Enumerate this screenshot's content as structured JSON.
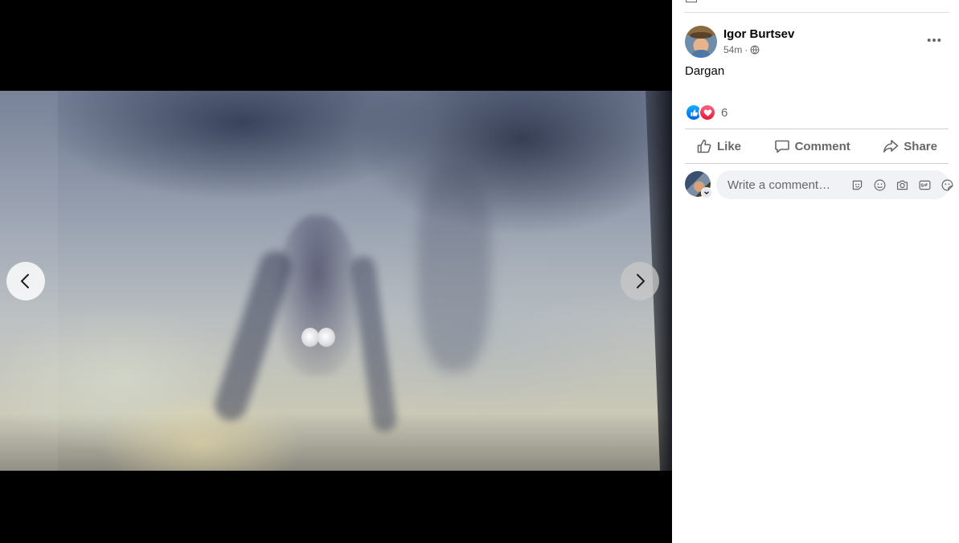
{
  "viewer": {
    "prev_icon": "chevron-left-icon",
    "next_icon": "chevron-right-icon"
  },
  "post": {
    "author": "Igor Burtsev",
    "time": "54m",
    "separator": "·",
    "privacy_icon": "globe-icon",
    "text": "Dargan",
    "reactions": {
      "types": [
        "like",
        "love"
      ],
      "count": "6"
    }
  },
  "actions": {
    "like_label": "Like",
    "comment_label": "Comment",
    "share_label": "Share"
  },
  "comment": {
    "placeholder": "Write a comment…",
    "tools": [
      "avatar-sticker-icon",
      "emoji-icon",
      "camera-icon",
      "gif-icon",
      "sticker-icon"
    ]
  },
  "colors": {
    "accent": "#1877f2",
    "secondary_text": "#65676b",
    "divider": "#ced0d4",
    "comment_bg": "#f0f2f5",
    "like_blue": "#0062df",
    "love_red": "#e61739"
  }
}
